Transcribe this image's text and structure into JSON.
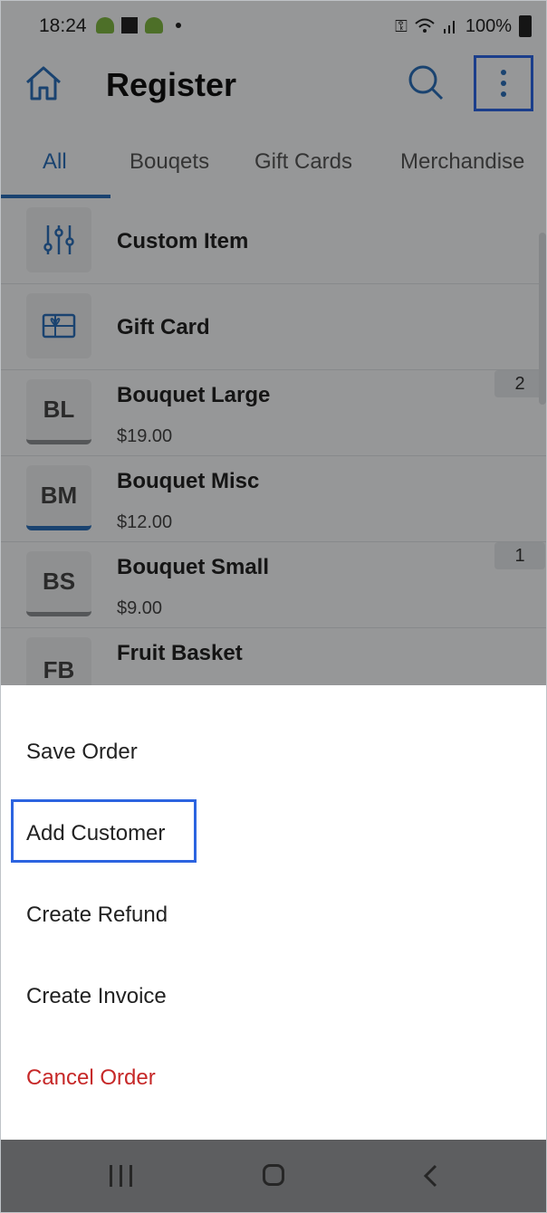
{
  "status_bar": {
    "time": "18:24",
    "battery": "100%"
  },
  "app_bar": {
    "title": "Register"
  },
  "tabs": [
    {
      "label": "All",
      "active": true
    },
    {
      "label": "Bouqets",
      "active": false
    },
    {
      "label": "Gift Cards",
      "active": false
    },
    {
      "label": "Merchandise",
      "active": false
    }
  ],
  "items": [
    {
      "name": "Custom Item",
      "icon": "sliders-icon"
    },
    {
      "name": "Gift Card",
      "icon": "gift-card-icon"
    },
    {
      "abbr": "BL",
      "name": "Bouquet Large",
      "price": "$19.00",
      "qty": "2"
    },
    {
      "abbr": "BM",
      "name": "Bouquet Misc",
      "price": "$12.00"
    },
    {
      "abbr": "BS",
      "name": "Bouquet Small",
      "price": "$9.00",
      "qty": "1"
    },
    {
      "abbr": "FB",
      "name": "Fruit Basket"
    }
  ],
  "menu": {
    "save_order": "Save Order",
    "add_customer": "Add Customer",
    "create_refund": "Create Refund",
    "create_invoice": "Create Invoice",
    "cancel_order": "Cancel Order"
  },
  "colors": {
    "accent": "#2a6db5",
    "danger": "#c62828",
    "highlight": "#2c64e0"
  }
}
